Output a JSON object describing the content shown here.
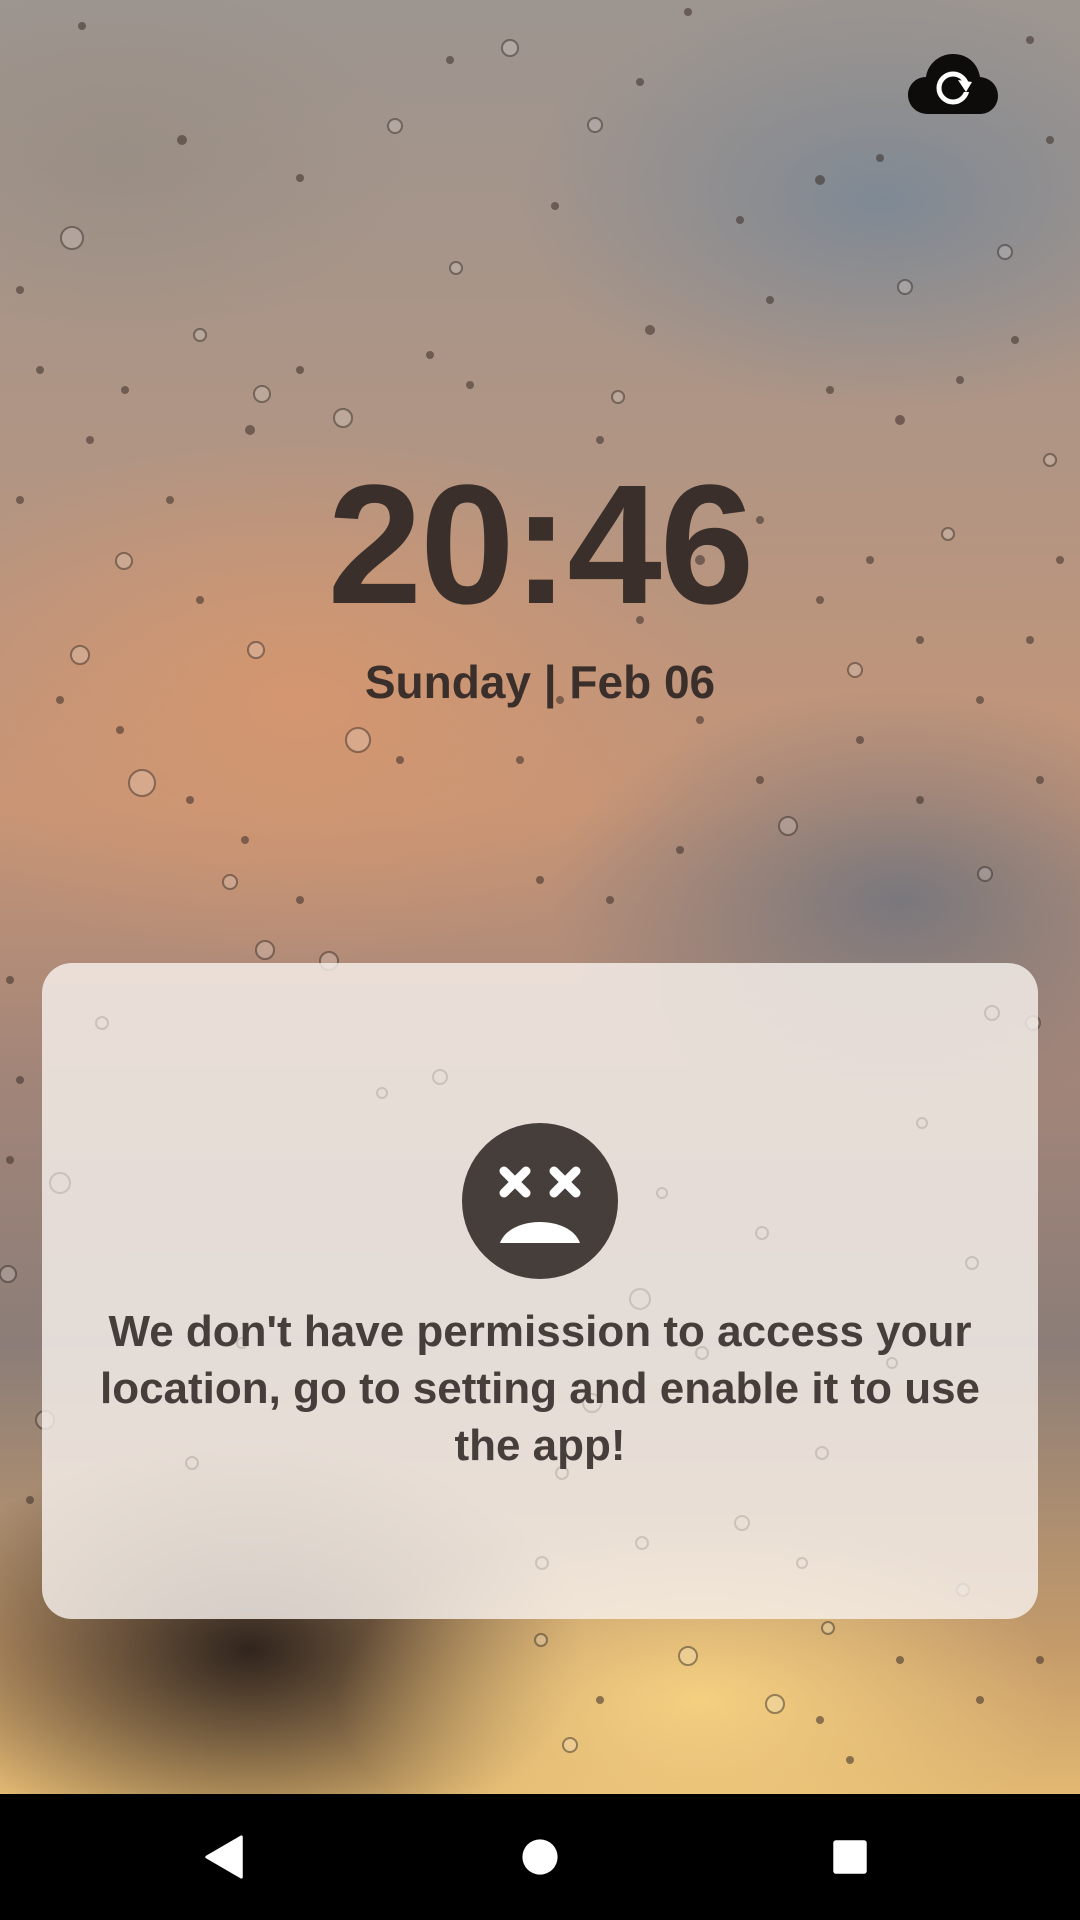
{
  "status": {
    "time": "20:46",
    "date": "Sunday | Feb 06"
  },
  "top_icon": {
    "name": "cloud-refresh-icon"
  },
  "error_card": {
    "icon": "sad-face-icon",
    "message": "We don't have permission to access your location, go to setting and enable it to use the app!"
  },
  "navbar": {
    "back_icon": "back-triangle-icon",
    "home_icon": "home-circle-icon",
    "recents_icon": "recents-square-icon"
  },
  "colors": {
    "text_dark": "#3a2f2b",
    "card_bg": "#f6f0ec",
    "navbar_bg": "#000000"
  }
}
